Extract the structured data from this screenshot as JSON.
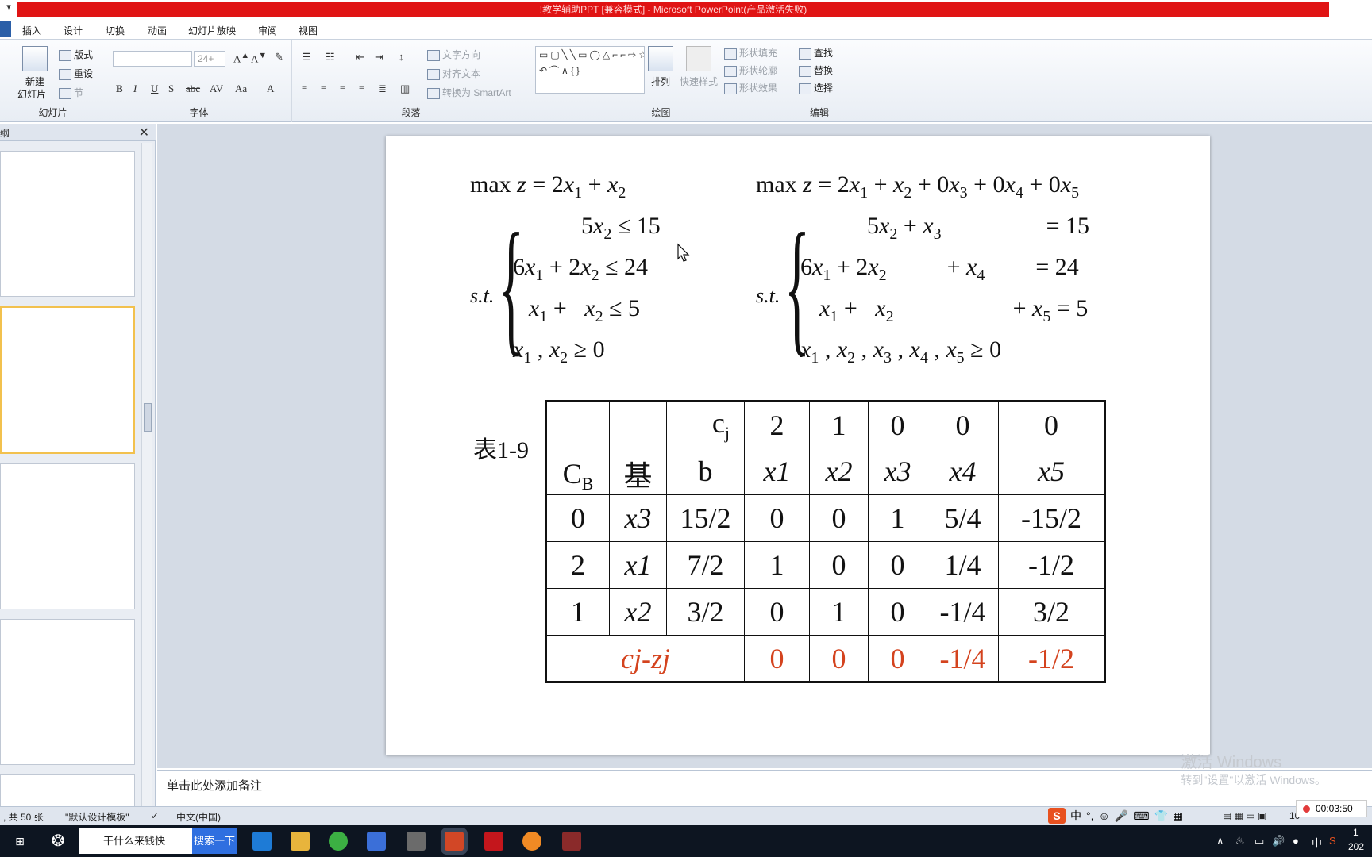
{
  "window": {
    "title": "!教学辅助PPT [兼容模式] - Microsoft PowerPoint(产品激活失败)"
  },
  "tabs": [
    "插入",
    "设计",
    "切换",
    "动画",
    "幻灯片放映",
    "审阅",
    "视图"
  ],
  "ribbon": {
    "slides_group": {
      "label": "幻灯片",
      "new_slide": "新建\n幻灯片",
      "new_slide_line1": "新建",
      "new_slide_line2": "幻灯片",
      "layout": "版式",
      "reset": "重设",
      "section": "节"
    },
    "font_group": {
      "label": "字体",
      "size_value": "24+",
      "buttons": [
        "B",
        "I",
        "U",
        "S",
        "abc",
        "AV",
        "Aa",
        "A"
      ]
    },
    "paragraph_group": {
      "label": "段落",
      "text_direction": "文字方向",
      "align_text": "对齐文本",
      "convert_smartart": "转换为 SmartArt"
    },
    "drawing_group": {
      "label": "绘图",
      "arrange": "排列",
      "quick_styles": "快速样式",
      "shape_fill": "形状填充",
      "shape_outline": "形状轮廓",
      "shape_effects": "形状效果"
    },
    "editing_group": {
      "label": "编辑",
      "find": "查找",
      "replace": "替换",
      "select": "选择"
    }
  },
  "left_pane": {
    "tab_label": "纲",
    "close": "✕"
  },
  "slide": {
    "left_model": {
      "objective": "max z = 2x1 + x2",
      "st_label": "s.t.",
      "c1": "5x2 ≤ 15",
      "c2": "6x1 + 2x2 ≤ 24",
      "c3": "x1 +  x2 ≤ 5",
      "c4": "x1, x2 ≥ 0"
    },
    "right_model": {
      "objective": "max z = 2x1 + x2 + 0x3 + 0x4 + 0x5",
      "st_label": "s.t.",
      "c1": "5x2 + x3 = 15",
      "c2": "6x1 + 2x2 + x4 = 24",
      "c3": "x1 + x2 + x5 = 5",
      "c4": "x1, x2, x3, x4, x5 ≥ 0"
    },
    "table_label": "表1-9",
    "table": {
      "header": {
        "cb": "C",
        "cb_sub": "B",
        "basis": "基",
        "cj": "c",
        "cj_sub": "j",
        "b": "b",
        "cj_values": [
          "2",
          "1",
          "0",
          "0",
          "0"
        ],
        "vars": [
          "x1",
          "x2",
          "x3",
          "x4",
          "x5"
        ]
      },
      "rows": [
        {
          "cb": "0",
          "basis": "x3",
          "b": "15/2",
          "values": [
            "0",
            "0",
            "1",
            "5/4",
            "-15/2"
          ]
        },
        {
          "cb": "2",
          "basis": "x1",
          "b": "7/2",
          "values": [
            "1",
            "0",
            "0",
            "1/4",
            "-1/2"
          ]
        },
        {
          "cb": "1",
          "basis": "x2",
          "b": "3/2",
          "values": [
            "0",
            "1",
            "0",
            "-1/4",
            "3/2"
          ]
        }
      ],
      "check_row": {
        "label": "cj-zj",
        "values": [
          "0",
          "0",
          "0",
          "-1/4",
          "-1/2"
        ]
      }
    }
  },
  "notes_placeholder": "单击此处添加备注",
  "watermark": {
    "line1": "激活 Windows",
    "line2": "转到\"设置\"以激活 Windows。"
  },
  "statusbar": {
    "slide_info": ", 共 50 张",
    "theme": "\"默认设计模板\"",
    "language": "中文(中国)",
    "zoom": "10"
  },
  "recorder": {
    "time": "00:03:50"
  },
  "taskbar": {
    "search_text": "干什么来钱快",
    "search_button": "搜索一下",
    "tray_lang": "中",
    "clock_line1": "1",
    "clock_line2": "202"
  },
  "colors": {
    "title_red": "#e01414",
    "check_row_red": "#d4431e",
    "selected_thumb": "#f2c14e"
  }
}
